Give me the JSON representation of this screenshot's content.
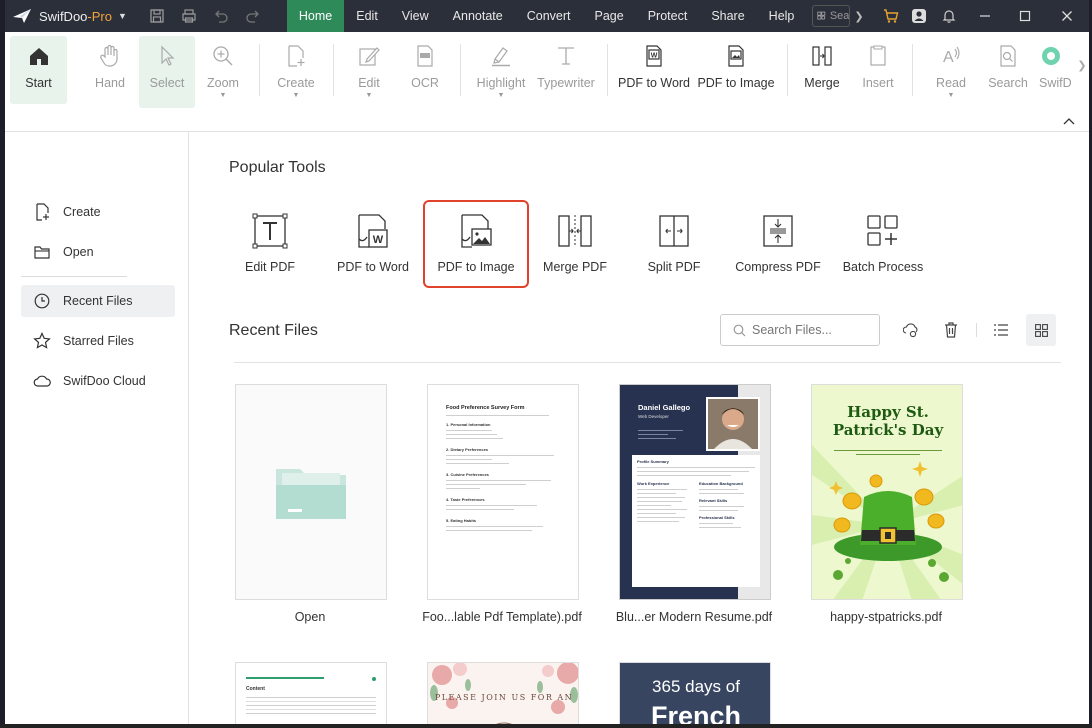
{
  "app": {
    "name": "SwifDoo",
    "edition": "-Pro"
  },
  "titlebar": {
    "menu": [
      "Home",
      "Edit",
      "View",
      "Annotate",
      "Convert",
      "Page",
      "Protect",
      "Share",
      "Help"
    ],
    "active_menu": "Home",
    "search_placeholder": "Sea"
  },
  "ribbon": {
    "start": "Start",
    "hand": "Hand",
    "select": "Select",
    "zoom": "Zoom",
    "create": "Create",
    "edit": "Edit",
    "ocr": "OCR",
    "highlight": "Highlight",
    "typewriter": "Typewriter",
    "pdf_to_word": "PDF to Word",
    "pdf_to_image": "PDF to Image",
    "merge": "Merge",
    "insert": "Insert",
    "read": "Read",
    "search": "Search",
    "swifdoo_ai": "SwifD"
  },
  "sidebar": {
    "create": "Create",
    "open": "Open",
    "recent": "Recent Files",
    "starred": "Starred Files",
    "cloud": "SwifDoo Cloud"
  },
  "main": {
    "popular_title": "Popular Tools",
    "tools": {
      "edit_pdf": "Edit PDF",
      "pdf_to_word": "PDF to Word",
      "pdf_to_image": "PDF to Image",
      "merge_pdf": "Merge PDF",
      "split_pdf": "Split PDF",
      "compress_pdf": "Compress PDF",
      "batch_process": "Batch Process"
    },
    "recent_title": "Recent Files",
    "search_placeholder": "Search Files...",
    "files": [
      {
        "name": "Open"
      },
      {
        "name": "Foo...lable Pdf Template).pdf"
      },
      {
        "name": "Blu...er Modern Resume.pdf"
      },
      {
        "name": "happy-stpatricks.pdf"
      }
    ],
    "thumb_food": {
      "title": "Food Preference Survey Form",
      "s1": "1. Personal Information",
      "s2": "2. Dietary Preferences",
      "s3": "3. Cuisine Preferences",
      "s4": "4. Taste Preferences",
      "s5": "5. Eating Habits"
    },
    "thumb_resume": {
      "name": "Daniel Gallego",
      "role": "Web Developer",
      "profile": "Profile Summary",
      "work": "Work Experience",
      "edu": "Education Background",
      "skills": "Relevant Skills",
      "pro_skills": "Professional Skills"
    },
    "thumb_patrick": {
      "line1": "Happy St.",
      "line2": "Patrick's Day"
    },
    "thumb_row2": {
      "content": "Content",
      "join": "PLEASE JOIN US FOR AN",
      "french_1": "365 days of",
      "french_2": "French"
    }
  },
  "colors": {
    "titlebar_bg": "#2b2f3a",
    "accent_green": "#2f8a5a",
    "highlight_red": "#e0432b",
    "resume_navy": "#26324f",
    "patrick_green": "#4caf2c"
  }
}
